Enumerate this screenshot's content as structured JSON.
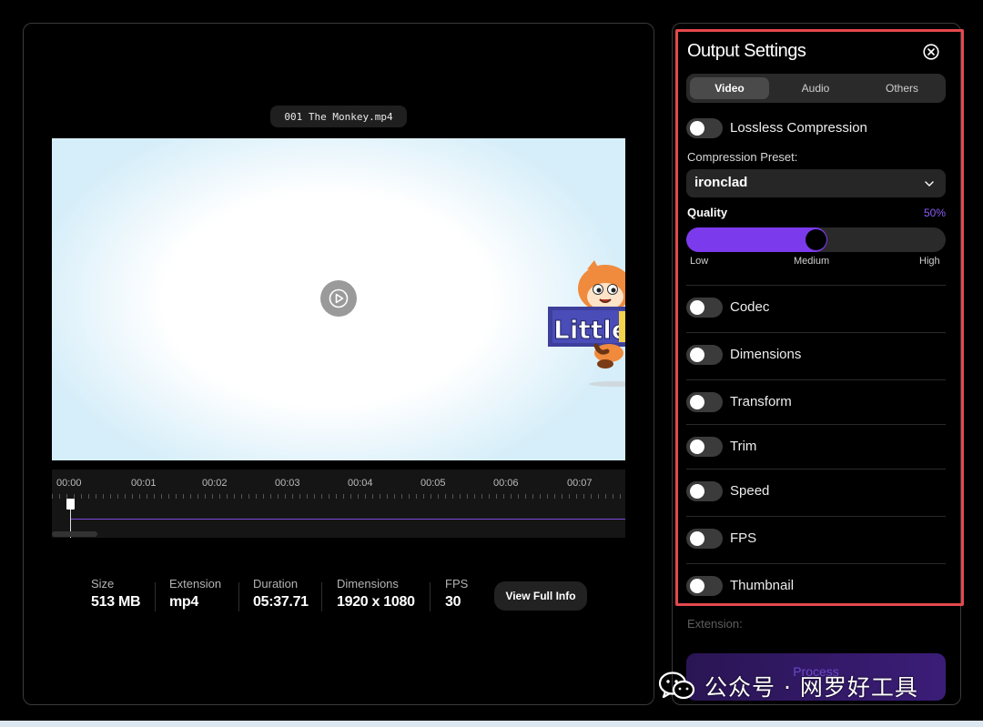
{
  "player": {
    "file_name": "001 The Monkey.mp4",
    "timeline_ticks": [
      "00:00",
      "00:01",
      "00:02",
      "00:03",
      "00:04",
      "00:05",
      "00:06",
      "00:07"
    ],
    "video_logo_text": "Little"
  },
  "file_info": {
    "size_label": "Size",
    "size_value": "513 MB",
    "extension_label": "Extension",
    "extension_value": "mp4",
    "duration_label": "Duration",
    "duration_value": "05:37.71",
    "dimensions_label": "Dimensions",
    "dimensions_value": "1920 x 1080",
    "fps_label": "FPS",
    "fps_value": "30",
    "view_full_info_label": "View Full Info"
  },
  "settings": {
    "title": "Output Settings",
    "tabs": [
      {
        "label": "Video",
        "active": true
      },
      {
        "label": "Audio",
        "active": false
      },
      {
        "label": "Others",
        "active": false
      }
    ],
    "lossless_label": "Lossless Compression",
    "lossless_on": false,
    "preset_label": "Compression Preset:",
    "preset_value": "ironclad",
    "quality_label": "Quality",
    "quality_value": "50%",
    "quality_fraction": 0.5,
    "quality_ticks": {
      "low": "Low",
      "medium": "Medium",
      "high": "High"
    },
    "options": [
      {
        "label": "Codec",
        "on": false
      },
      {
        "label": "Dimensions",
        "on": false
      },
      {
        "label": "Transform",
        "on": false
      },
      {
        "label": "Trim",
        "on": false
      },
      {
        "label": "Speed",
        "on": false
      },
      {
        "label": "FPS",
        "on": false
      },
      {
        "label": "Thumbnail",
        "on": false
      }
    ],
    "extension_label": "Extension:",
    "process_label": "Process"
  },
  "watermark": {
    "text": "公众号 · 网罗好工具",
    "icon": "wechat-icon"
  },
  "colors": {
    "accent": "#7c3aed",
    "highlight": "#e5484d",
    "background": "#000000"
  }
}
